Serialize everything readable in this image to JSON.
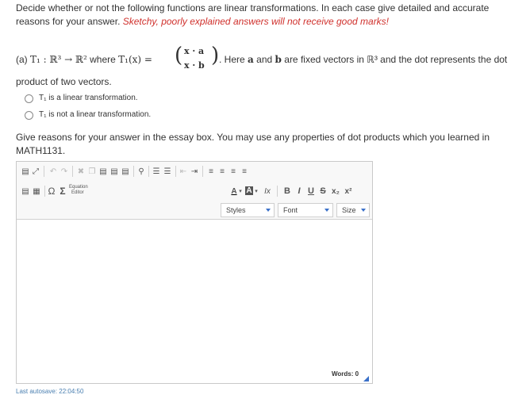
{
  "question": {
    "intro_line1": "Decide whether or not the following functions are linear transformations.  In each case give detailed and accurate",
    "intro_line2": "reasons for your answer.",
    "warning": "Sketchy, poorly explained answers will not receive good marks!",
    "part_label": "(a)",
    "func_def": "T₁ : ℝ³ → ℝ²",
    "where_text": "where",
    "func_lhs": "T₁(x) =",
    "vector_top": "x · a",
    "vector_bottom": "x · b",
    "after_vector": ". Here",
    "bold_a": "a",
    "and_text": "and",
    "bold_b": "b",
    "fixed_text": "are fixed vectors in ℝ³ and the dot represents the dot",
    "product_text": "product of two vectors.",
    "options": [
      {
        "label": "T₁ is a linear transformation."
      },
      {
        "label": "T₁ is not a linear transformation."
      }
    ],
    "reasons_line1": "Give reasons for your answer in the essay box.  You may use any properties of dot products which you learned in",
    "reasons_line2": "MATH1131."
  },
  "toolbar": {
    "equation_editor_line1": "Equation",
    "equation_editor_line2": "Editor",
    "omega": "Ω",
    "sigma": "Σ",
    "text_color": "A",
    "bg_color": "A",
    "remove_format": "Ix",
    "bold": "B",
    "italic": "I",
    "underline": "U",
    "strike": "S",
    "subscript": "x₂",
    "superscript": "x²",
    "styles_label": "Styles",
    "font_label": "Font",
    "size_label": "Size"
  },
  "editor": {
    "word_count": "Words: 0"
  },
  "autosave": "Last autosave: 22:04:50",
  "colors": {
    "warning": "#d0312d",
    "accent": "#3a70c9",
    "autosave": "#4a7fb0"
  }
}
